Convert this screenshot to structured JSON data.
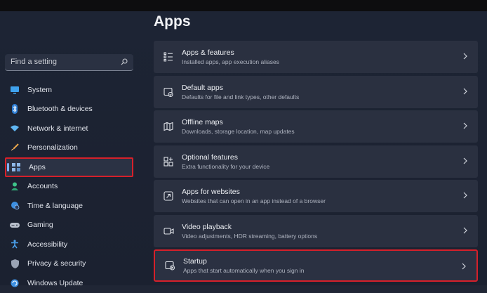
{
  "page": {
    "title": "Apps"
  },
  "search": {
    "placeholder": "Find a setting"
  },
  "sidebar": {
    "items": [
      {
        "label": "System",
        "icon": "monitor-icon"
      },
      {
        "label": "Bluetooth & devices",
        "icon": "bluetooth-icon"
      },
      {
        "label": "Network & internet",
        "icon": "wifi-icon"
      },
      {
        "label": "Personalization",
        "icon": "brush-icon"
      },
      {
        "label": "Apps",
        "icon": "apps-icon",
        "selected": true
      },
      {
        "label": "Accounts",
        "icon": "person-icon"
      },
      {
        "label": "Time & language",
        "icon": "globe-clock-icon"
      },
      {
        "label": "Gaming",
        "icon": "gamepad-icon"
      },
      {
        "label": "Accessibility",
        "icon": "accessibility-icon"
      },
      {
        "label": "Privacy & security",
        "icon": "shield-icon"
      },
      {
        "label": "Windows Update",
        "icon": "update-icon"
      }
    ]
  },
  "main": {
    "items": [
      {
        "title": "Apps & features",
        "desc": "Installed apps, app execution aliases",
        "icon": "list-icon"
      },
      {
        "title": "Default apps",
        "desc": "Defaults for file and link types, other defaults",
        "icon": "default-apps-icon"
      },
      {
        "title": "Offline maps",
        "desc": "Downloads, storage location, map updates",
        "icon": "map-icon"
      },
      {
        "title": "Optional features",
        "desc": "Extra functionality for your device",
        "icon": "add-feature-icon"
      },
      {
        "title": "Apps for websites",
        "desc": "Websites that can open in an app instead of a browser",
        "icon": "app-link-icon"
      },
      {
        "title": "Video playback",
        "desc": "Video adjustments, HDR streaming, battery options",
        "icon": "video-icon"
      },
      {
        "title": "Startup",
        "desc": "Apps that start automatically when you sign in",
        "icon": "startup-icon",
        "highlighted": true
      }
    ]
  },
  "colors": {
    "highlight": "#d6202a",
    "accent": "#7fb3ff",
    "background": "#202635",
    "card": "#2a3040"
  }
}
